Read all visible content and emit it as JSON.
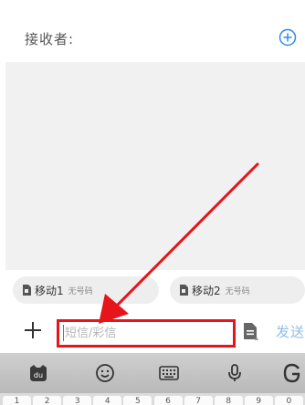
{
  "header": {
    "recipient_label": "接收者:",
    "add_icon": "add-circle-icon"
  },
  "sims": [
    {
      "name": "移动1",
      "number_status": "无号码"
    },
    {
      "name": "移动2",
      "number_status": "无号码"
    }
  ],
  "composer": {
    "placeholder": "短信/彩信",
    "value": "",
    "send_label": "发送"
  },
  "keyboard": {
    "toolbar": [
      "baidu-logo-icon",
      "emoji-icon",
      "keyboard-icon",
      "microphone-icon",
      "g-icon"
    ],
    "number_row": [
      "1",
      "2",
      "3",
      "4",
      "5",
      "6",
      "7",
      "8",
      "9",
      "0"
    ]
  },
  "annotation": {
    "color": "#e5151b"
  }
}
